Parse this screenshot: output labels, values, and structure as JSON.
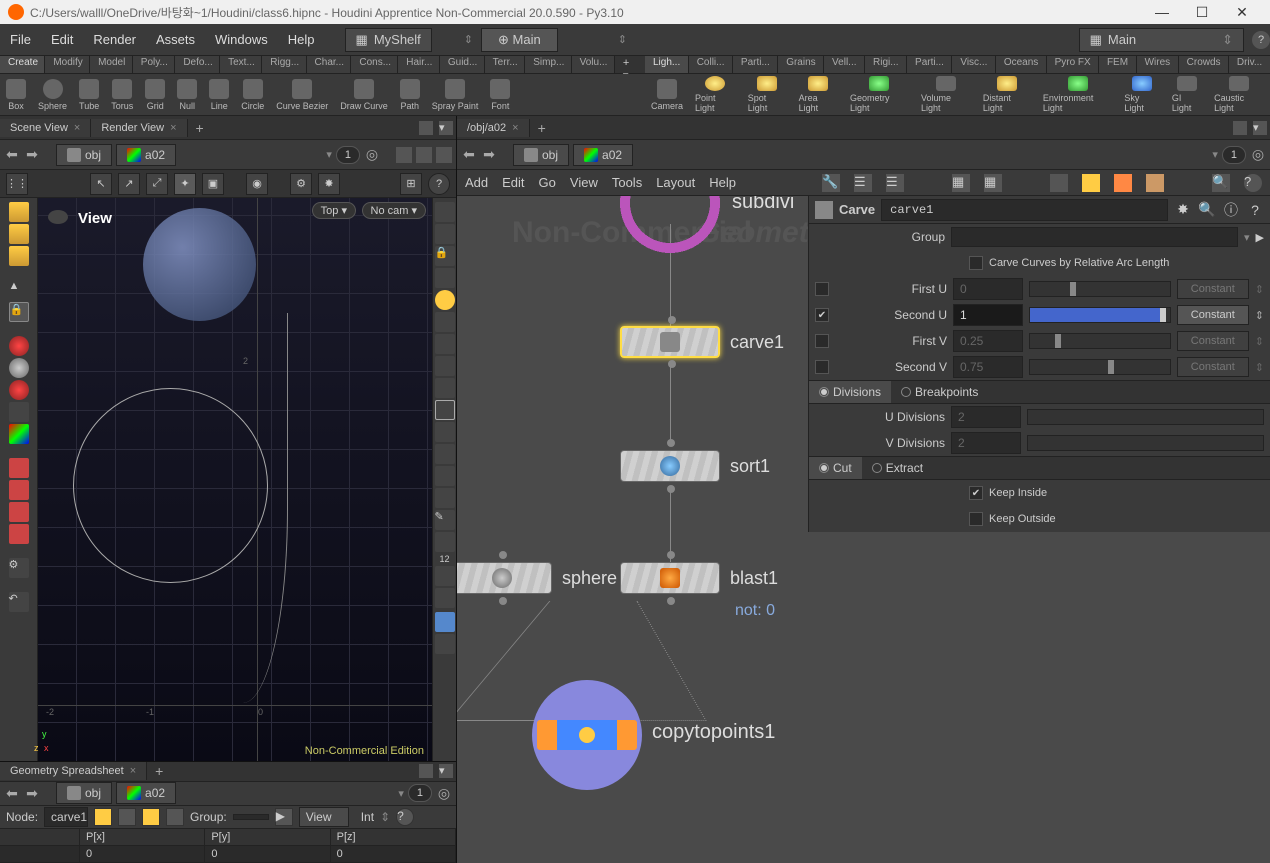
{
  "window": {
    "title": "C:/Users/walll/OneDrive/바탕화~1/Houdini/class6.hipnc - Houdini Apprentice Non-Commercial 20.0.590 - Py3.10"
  },
  "menubar": [
    "File",
    "Edit",
    "Render",
    "Assets",
    "Windows",
    "Help"
  ],
  "shelf": {
    "selector": "MyShelf",
    "main_tab": "Main",
    "right_selector": "Main"
  },
  "shelf_tabs_left": [
    "Create",
    "Modify",
    "Model",
    "Poly...",
    "Defo...",
    "Text...",
    "Rigg...",
    "Char...",
    "Cons...",
    "Hair...",
    "Guid...",
    "Terr...",
    "Simp...",
    "Volu..."
  ],
  "shelf_tabs_right": [
    "Ligh...",
    "Colli...",
    "Parti...",
    "Grains",
    "Vell...",
    "Rigi...",
    "Parti...",
    "Visc...",
    "Oceans",
    "Pyro FX",
    "FEM",
    "Wires",
    "Crowds",
    "Driv..."
  ],
  "tools_left": [
    "Box",
    "Sphere",
    "Tube",
    "Torus",
    "Grid",
    "Null",
    "Line",
    "Circle",
    "Curve Bezier",
    "Draw Curve",
    "Path",
    "Spray Paint",
    "Font"
  ],
  "tools_right": [
    "Camera",
    "Point Light",
    "Spot Light",
    "Area Light",
    "Geometry Light",
    "Volume Light",
    "Distant Light",
    "Environment Light",
    "Sky Light",
    "GI Light",
    "Caustic Light"
  ],
  "left_tabs": [
    "Scene View",
    "Render View"
  ],
  "right_tab": "/obj/a02",
  "path": {
    "seg1": "obj",
    "seg2": "a02",
    "num": "1"
  },
  "viewport": {
    "label": "View",
    "top_dd": "Top ▾",
    "cam_dd": "No cam ▾",
    "watermark": "Non-Commercial Edition",
    "axis_labels": {
      "x": "x",
      "y": "y",
      "z": "z"
    },
    "nums": [
      "-2",
      "-1",
      "0",
      "2"
    ]
  },
  "network_menu": [
    "Add",
    "Edit",
    "Go",
    "View",
    "Tools",
    "Layout",
    "Help"
  ],
  "nodes": {
    "bg_text1": "Non-Commercial",
    "bg_text2": "Geometry",
    "subdivide": "subdivi",
    "carve": "carve1",
    "sort": "sort1",
    "sphere": "sphere",
    "blast": "blast1",
    "blast_sub": "not: 0",
    "copytopoints": "copytopoints1"
  },
  "params": {
    "op_type": "Carve",
    "op_name": "carve1",
    "group_label": "Group",
    "carve_check_label": "Carve Curves by Relative Arc Length",
    "first_u": {
      "label": "First U",
      "value": "0",
      "menu": "Constant"
    },
    "second_u": {
      "label": "Second U",
      "value": "1",
      "menu": "Constant"
    },
    "first_v": {
      "label": "First V",
      "value": "0.25",
      "menu": "Constant"
    },
    "second_v": {
      "label": "Second V",
      "value": "0.75",
      "menu": "Constant"
    },
    "tab_divisions": "Divisions",
    "tab_breakpoints": "Breakpoints",
    "u_div": {
      "label": "U Divisions",
      "value": "2"
    },
    "v_div": {
      "label": "V Divisions",
      "value": "2"
    },
    "tab_cut": "Cut",
    "tab_extract": "Extract",
    "keep_inside": "Keep Inside",
    "keep_outside": "Keep Outside"
  },
  "geo_spread": {
    "tab": "Geometry Spreadsheet",
    "node_label": "Node:",
    "node_value": "carve1",
    "group_label": "Group:",
    "view_label": "View",
    "int_label": "Int",
    "headers": [
      "",
      "P[x]",
      "P[y]",
      "P[z]"
    ],
    "row0": [
      "0",
      "0",
      "0"
    ]
  }
}
